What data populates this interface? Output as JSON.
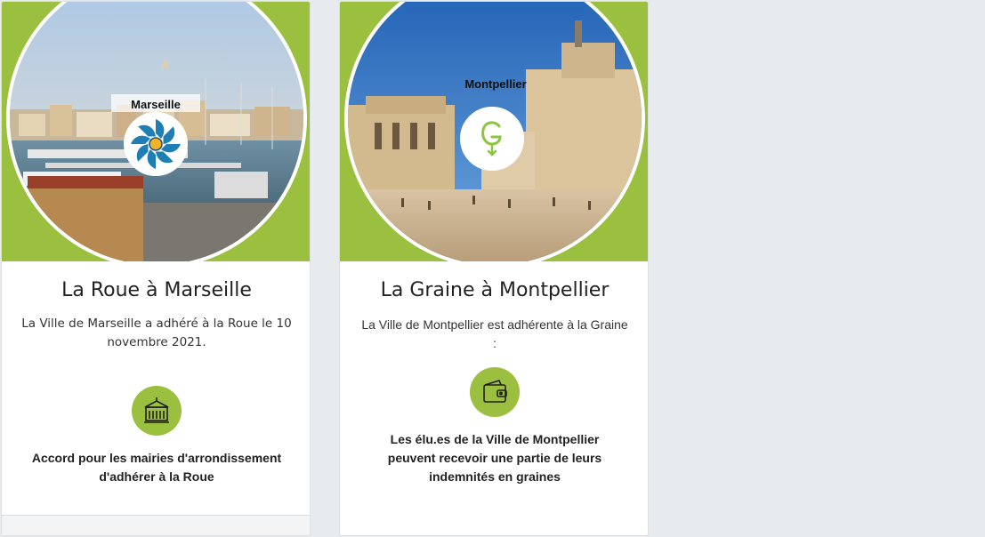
{
  "cards": [
    {
      "city_label": "Marseille",
      "title": "La Roue à Marseille",
      "description": "La Ville de Marseille a adhéré à la Roue le 10 novembre 2021.",
      "feature_icon": "town-hall-icon",
      "feature_text": "Accord pour les mairies d'arrondissement d'adhérer à la Roue"
    },
    {
      "city_label": "Montpellier",
      "title": "La Graine à Montpellier",
      "description": "La Ville de Montpellier est adhérente à la Graine :",
      "feature_icon": "wallet-icon",
      "feature_text": "Les élu.es de la Ville de Montpellier peuvent recevoir une partie de leurs indemnités en graines"
    }
  ],
  "colors": {
    "accent_green": "#9bbf3e",
    "page_background": "#e8ebee",
    "card_background": "#ffffff",
    "roue_logo_blue": "#1f7fb5",
    "roue_logo_center": "#f2b325",
    "graine_logo_green": "#8cc63f"
  }
}
